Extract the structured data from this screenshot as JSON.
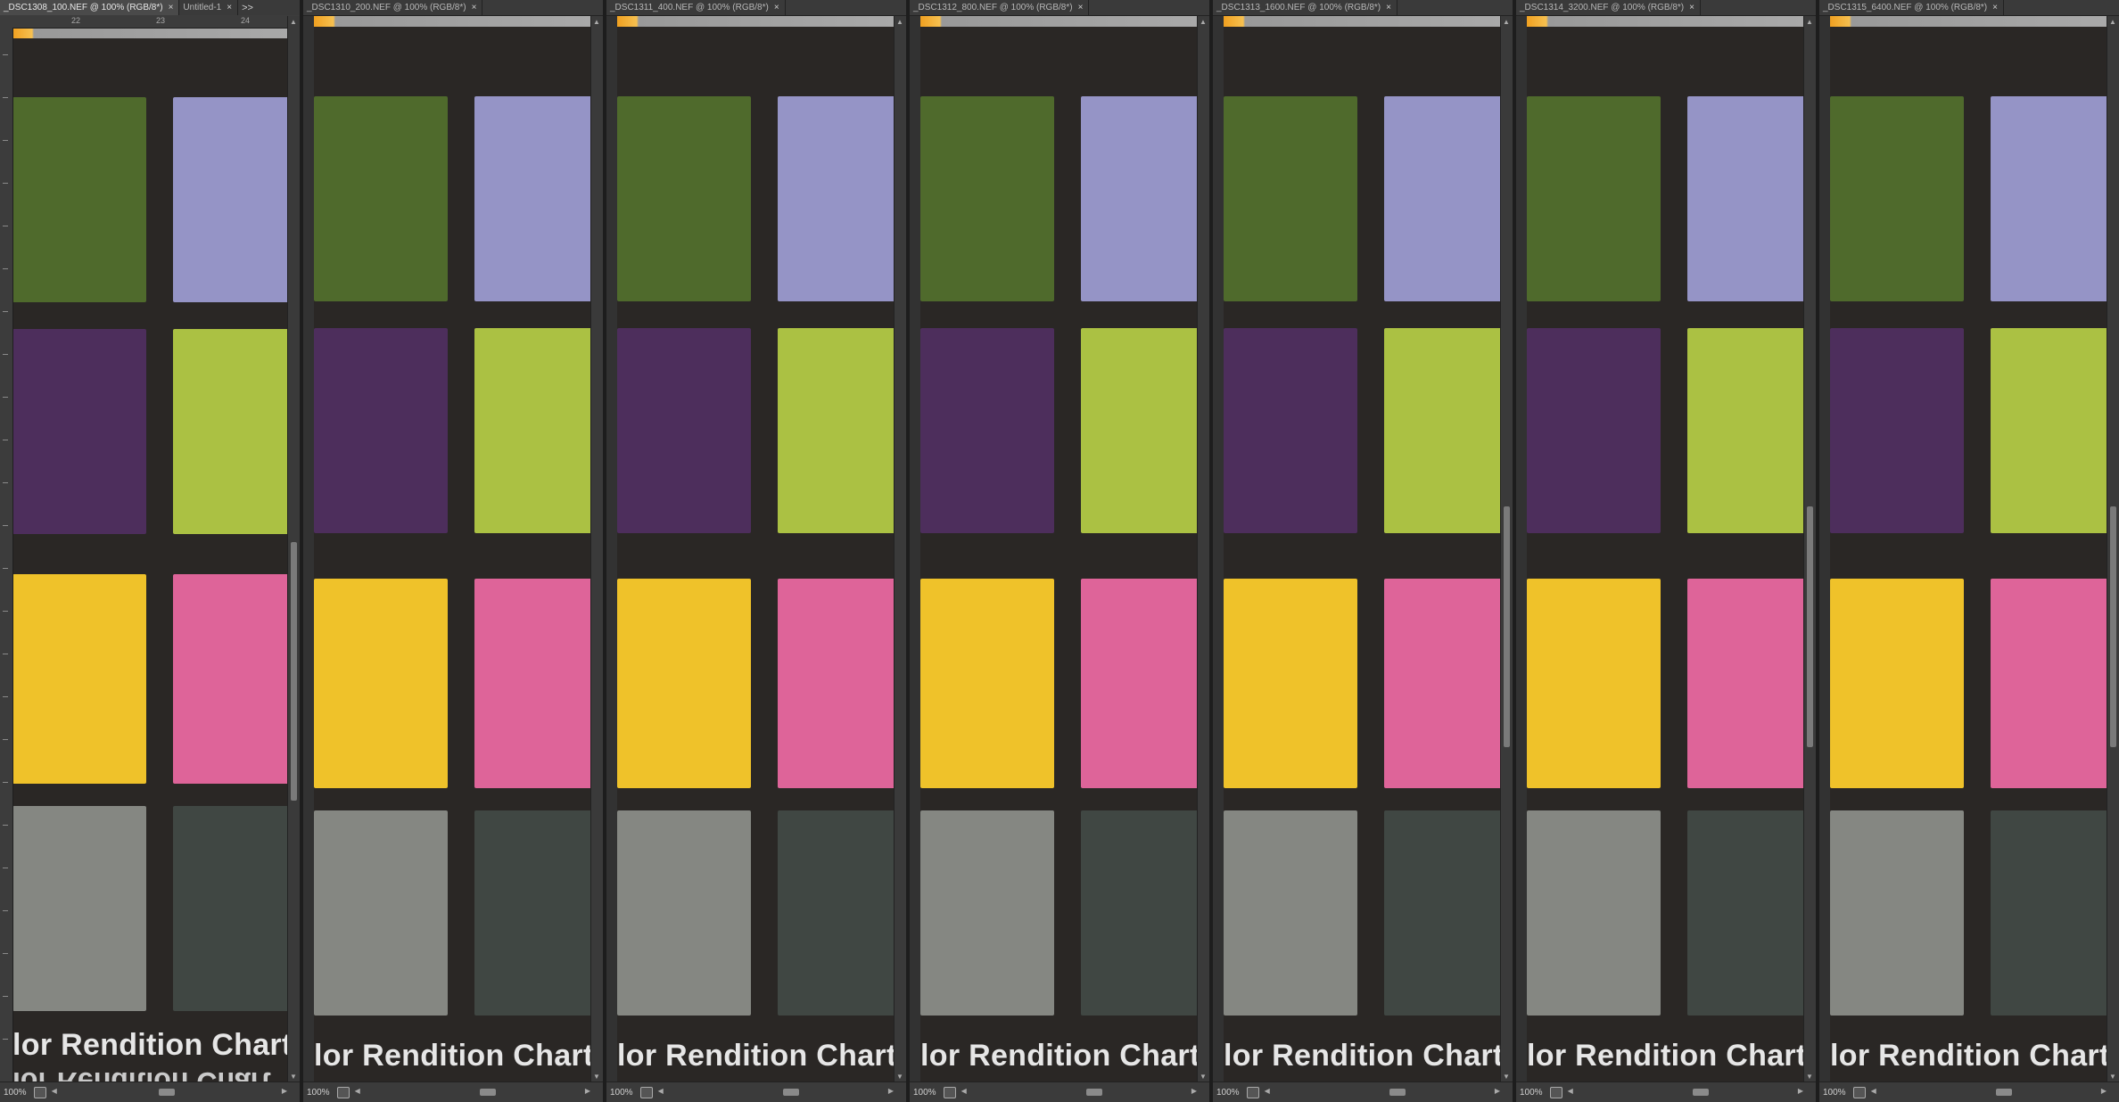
{
  "panels": [
    {
      "tabs": [
        {
          "label": "_DSC1308_100.NEF @ 100% (RGB/8*)",
          "active": true
        },
        {
          "label": "Untitled-1",
          "active": false
        }
      ],
      "overflow": ">>",
      "rulers": true,
      "ruler_labels": [
        "22",
        "23",
        "24"
      ],
      "chart_text": "lor Rendition Chart",
      "chart_text_mirror": "lor Rendition Chart",
      "zoom": "100%"
    },
    {
      "tabs": [
        {
          "label": "_DSC1310_200.NEF @ 100% (RGB/8*)",
          "active": false
        }
      ],
      "chart_text": "lor Rendition Chart",
      "zoom": "100%"
    },
    {
      "tabs": [
        {
          "label": "_DSC1311_400.NEF @ 100% (RGB/8*)",
          "active": false
        }
      ],
      "chart_text": "lor Rendition Chart",
      "zoom": "100%"
    },
    {
      "tabs": [
        {
          "label": "_DSC1312_800.NEF @ 100% (RGB/8*)",
          "active": false
        }
      ],
      "chart_text": "lor Rendition Chart",
      "zoom": "100%"
    },
    {
      "tabs": [
        {
          "label": "_DSC1313_1600.NEF @ 100% (RGB/8*)",
          "active": false
        }
      ],
      "chart_text": "lor Rendition Chart",
      "zoom": "100%"
    },
    {
      "tabs": [
        {
          "label": "_DSC1314_3200.NEF @ 100% (RGB/8*)",
          "active": false
        }
      ],
      "chart_text": "lor Rendition Chart",
      "zoom": "100%"
    },
    {
      "tabs": [
        {
          "label": "_DSC1315_6400.NEF @ 100% (RGB/8*)",
          "active": false
        }
      ],
      "chart_text": "lor Rendition Chart",
      "zoom": "100%"
    }
  ],
  "patch_colors": [
    [
      "#4f6a2c",
      "#9594c6"
    ],
    [
      "#4d2e5c",
      "#abc143"
    ],
    [
      "#efc22a",
      "#de6499"
    ],
    [
      "#858782",
      "#404743"
    ]
  ],
  "colors": {
    "workspace": "#2b2b2b",
    "panel": "#323232",
    "chart_background": "#2a2725"
  }
}
